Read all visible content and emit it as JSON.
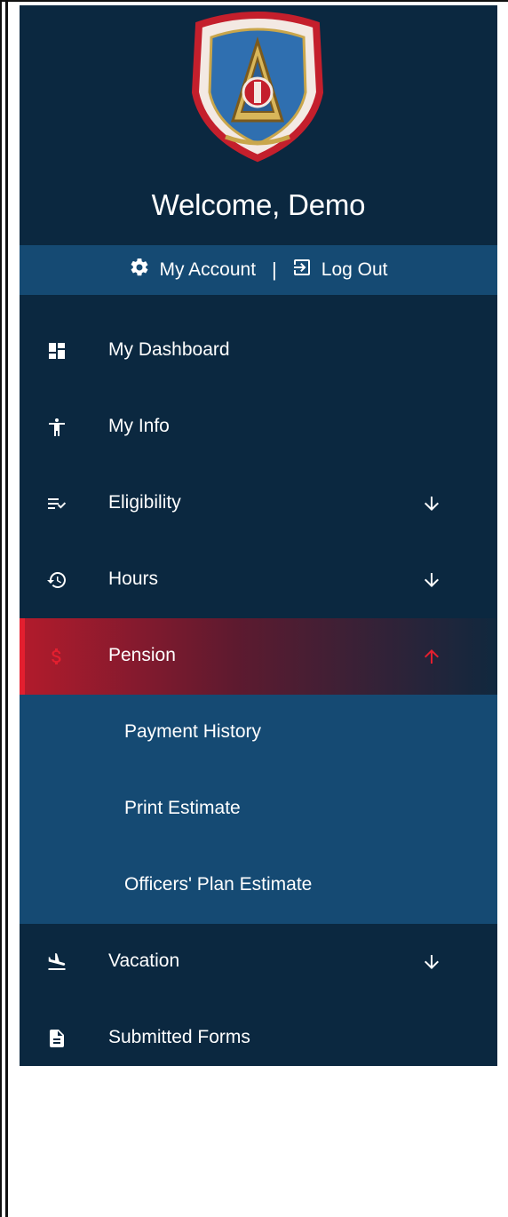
{
  "header": {
    "welcome": "Welcome, Demo"
  },
  "account_bar": {
    "my_account": "My Account",
    "separator": "|",
    "log_out": "Log Out"
  },
  "nav": [
    {
      "label": "My Dashboard",
      "icon": "dashboard-icon"
    },
    {
      "label": "My Info",
      "icon": "person-icon"
    },
    {
      "label": "Eligibility",
      "icon": "list-check-icon",
      "arrow": "arrow-down-icon"
    },
    {
      "label": "Hours",
      "icon": "history-icon",
      "arrow": "arrow-down-icon"
    },
    {
      "label": "Pension",
      "icon": "dollar-icon",
      "arrow": "arrow-up-icon",
      "active": true
    },
    {
      "label": "Vacation",
      "icon": "flight-land-icon",
      "arrow": "arrow-down-icon"
    },
    {
      "label": "Submitted Forms",
      "icon": "document-icon"
    }
  ],
  "pension_submenu": [
    {
      "label": "Payment History"
    },
    {
      "label": "Print Estimate"
    },
    {
      "label": "Officers' Plan Estimate"
    }
  ],
  "colors": {
    "sidebar_bg": "#0b2840",
    "bar_bg": "#154a73",
    "active_accent": "#e31f2f"
  }
}
